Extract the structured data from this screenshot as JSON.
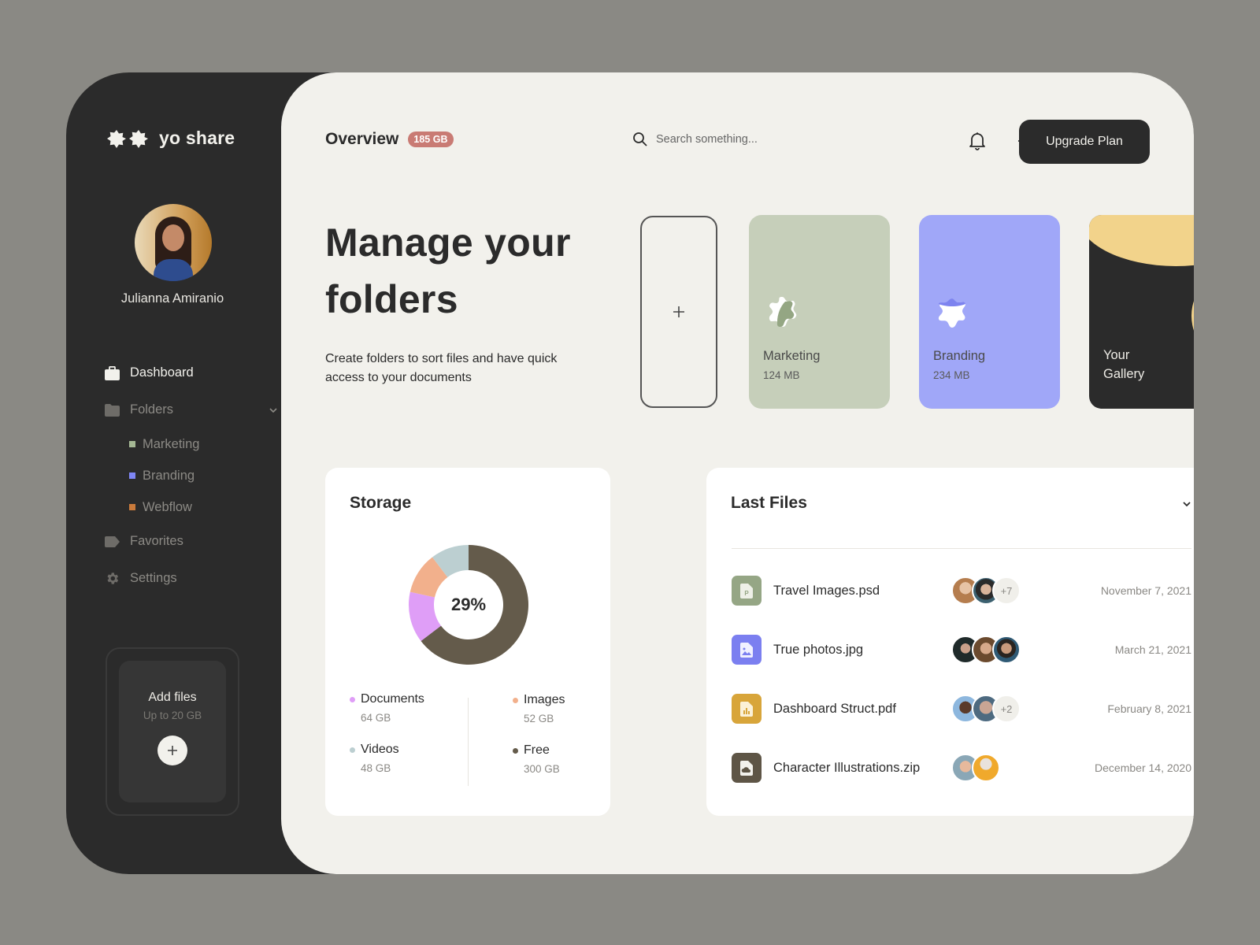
{
  "app": {
    "name": "yo share"
  },
  "user": {
    "name": "Julianna Amiranio"
  },
  "sidebar": {
    "items": [
      {
        "label": "Dashboard",
        "icon": "briefcase-icon",
        "active": true
      },
      {
        "label": "Folders",
        "icon": "folder-icon",
        "expanded": true
      },
      {
        "label": "Favorites",
        "icon": "tag-icon"
      },
      {
        "label": "Settings",
        "icon": "gear-icon"
      }
    ],
    "folders": [
      {
        "label": "Marketing",
        "color": "#a5b894"
      },
      {
        "label": "Branding",
        "color": "#7f86f4"
      },
      {
        "label": "Webflow",
        "color": "#c97a3b"
      }
    ],
    "add_files": {
      "title": "Add files",
      "subtitle": "Up to 20 GB"
    }
  },
  "header": {
    "title": "Overview",
    "badge": "185 GB",
    "search_placeholder": "Search something...",
    "upgrade_label": "Upgrade Plan"
  },
  "hero": {
    "title_line1": "Manage your",
    "title_line2": "folders",
    "subtitle": "Create folders to sort files and  have quick access to your documents"
  },
  "folders": [
    {
      "name": "Marketing",
      "size": "124 MB",
      "color": "#c6cfba"
    },
    {
      "name": "Branding",
      "size": "234 MB",
      "color": "#a0a7f8"
    },
    {
      "name_line1": "Your",
      "name_line2": "Gallery",
      "color": "#2b2b2b"
    }
  ],
  "storage": {
    "title": "Storage",
    "center_label": "29%",
    "legend": [
      {
        "name": "Documents",
        "value": "64 GB",
        "color": "#df9ef7"
      },
      {
        "name": "Images",
        "value": "52 GB",
        "color": "#f2b08c"
      },
      {
        "name": "Videos",
        "value": "48 GB",
        "color": "#bccfd1"
      },
      {
        "name": "Free",
        "value": "300 GB",
        "color": "#645b4b"
      }
    ]
  },
  "chart_data": {
    "type": "pie",
    "title": "Storage",
    "center_label": "29%",
    "categories": [
      "Free",
      "Documents",
      "Images",
      "Videos"
    ],
    "values": [
      300,
      64,
      52,
      48
    ],
    "unit": "GB",
    "colors": [
      "#645b4b",
      "#df9ef7",
      "#f2b08c",
      "#bccfd1"
    ],
    "donut": true
  },
  "last_files": {
    "title": "Last Files",
    "files": [
      {
        "name": "Travel Images.psd",
        "date": "November 7, 2021",
        "type": "psd",
        "color": "#95a685",
        "more": "+7"
      },
      {
        "name": "True photos.jpg",
        "date": "March 21, 2021",
        "type": "image",
        "color": "#7b7ff0",
        "more": ""
      },
      {
        "name": "Dashboard Struct.pdf",
        "date": "February 8, 2021",
        "type": "chart",
        "color": "#d8a53a",
        "more": "+2"
      },
      {
        "name": "Character Illustrations.zip",
        "date": "December 14, 2020",
        "type": "cloud",
        "color": "#5e5546",
        "more": ""
      }
    ]
  }
}
